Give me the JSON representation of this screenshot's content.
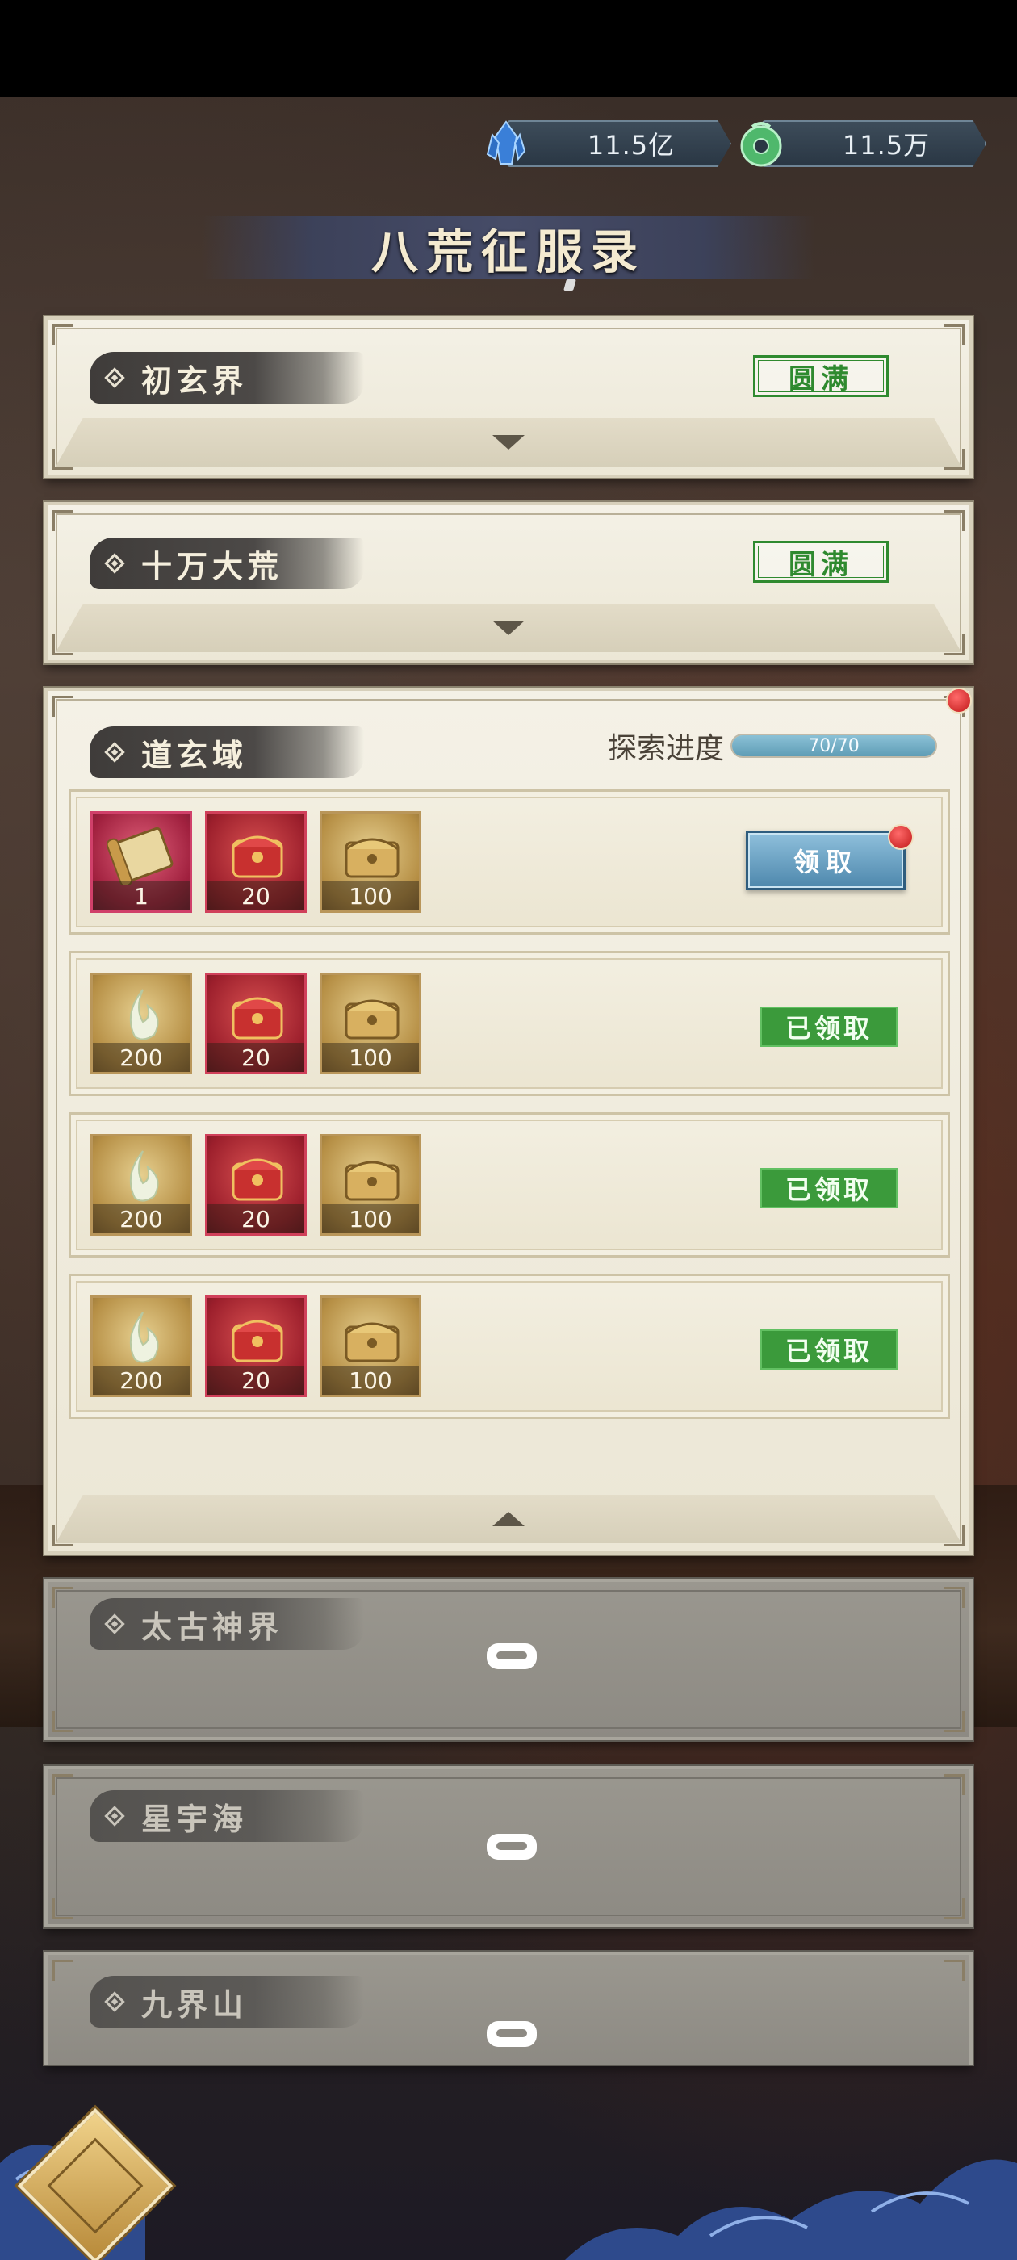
{
  "currency": [
    {
      "value": "11.5亿",
      "icon": "crystal-icon",
      "color": "#4a90e2"
    },
    {
      "value": "11.5万",
      "icon": "jade-coin-icon",
      "color": "#5ec07a"
    }
  ],
  "title": "八荒征服录",
  "panels": {
    "chuxuan": {
      "name": "初玄界",
      "status": "圆满"
    },
    "shiwan": {
      "name": "十万大荒",
      "status": "圆满"
    },
    "daoxuan": {
      "name": "道玄域",
      "progress_label": "探索进度",
      "progress_text": "70/70",
      "progress_fraction": 1.0
    },
    "taigu": {
      "name": "太古神界"
    },
    "xingyu": {
      "name": "星宇海"
    },
    "jiujie": {
      "name": "九界山"
    }
  },
  "rewards": [
    {
      "items": [
        {
          "icon": "scroll-icon",
          "qty": "1",
          "frame": "magenta"
        },
        {
          "icon": "red-chest-icon",
          "qty": "20",
          "frame": "red"
        },
        {
          "icon": "gold-chest-icon",
          "qty": "100",
          "frame": "gold"
        }
      ],
      "action": "领取"
    },
    {
      "items": [
        {
          "icon": "spirit-flame-icon",
          "qty": "200",
          "frame": "gold"
        },
        {
          "icon": "red-chest-icon",
          "qty": "20",
          "frame": "red"
        },
        {
          "icon": "gold-chest-icon",
          "qty": "100",
          "frame": "gold"
        }
      ],
      "status": "已领取"
    },
    {
      "items": [
        {
          "icon": "spirit-flame-icon",
          "qty": "200",
          "frame": "gold"
        },
        {
          "icon": "red-chest-icon",
          "qty": "20",
          "frame": "red"
        },
        {
          "icon": "gold-chest-icon",
          "qty": "100",
          "frame": "gold"
        }
      ],
      "status": "已领取"
    },
    {
      "items": [
        {
          "icon": "spirit-flame-icon",
          "qty": "200",
          "frame": "gold"
        },
        {
          "icon": "red-chest-icon",
          "qty": "20",
          "frame": "red"
        },
        {
          "icon": "gold-chest-icon",
          "qty": "100",
          "frame": "gold"
        }
      ],
      "status": "已领取"
    }
  ],
  "colors": {
    "claimed_green": "#3b9a3b",
    "claim_blue": "#4d87ac",
    "progress_blue": "#6aa6bf",
    "notify_red": "#c01818"
  }
}
